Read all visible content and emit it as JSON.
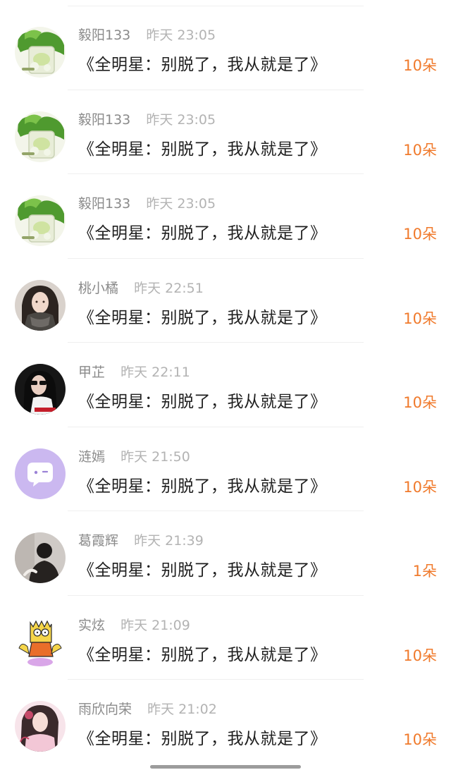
{
  "comments": [
    {
      "name": "毅阳133",
      "time": "昨天 23:05",
      "text": "《全明星：别脱了，我从就是了》",
      "gift": "10朵",
      "avatar": "cocktail"
    },
    {
      "name": "毅阳133",
      "time": "昨天 23:05",
      "text": "《全明星：别脱了，我从就是了》",
      "gift": "10朵",
      "avatar": "cocktail"
    },
    {
      "name": "毅阳133",
      "time": "昨天 23:05",
      "text": "《全明星：别脱了，我从就是了》",
      "gift": "10朵",
      "avatar": "cocktail"
    },
    {
      "name": "桃小橘",
      "time": "昨天 22:51",
      "text": "《全明星：别脱了，我从就是了》",
      "gift": "10朵",
      "avatar": "girl-scarf"
    },
    {
      "name": "甲芷",
      "time": "昨天 22:11",
      "text": "《全明星：别脱了，我从就是了》",
      "gift": "10朵",
      "avatar": "girl-sunglasses"
    },
    {
      "name": "涟嫣",
      "time": "昨天 21:50",
      "text": "《全明星：别脱了，我从就是了》",
      "gift": "10朵",
      "avatar": "purple-chat-bubble"
    },
    {
      "name": "葛霞辉",
      "time": "昨天 21:39",
      "text": "《全明星：别脱了，我从就是了》",
      "gift": "1朵",
      "avatar": "dark-figure"
    },
    {
      "name": "实炫",
      "time": "昨天 21:09",
      "text": "《全明星：别脱了，我从就是了》",
      "gift": "10朵",
      "avatar": "cartoon-boy"
    },
    {
      "name": "雨欣向荣",
      "time": "昨天 21:02",
      "text": "《全明星：别脱了，我从就是了》",
      "gift": "10朵",
      "avatar": "girl-pink"
    }
  ],
  "colors": {
    "name": "#8a8a8a",
    "time": "#b3b3b3",
    "text": "#1f1f1f",
    "gift": "#f07a2c",
    "divider": "#efefef"
  }
}
